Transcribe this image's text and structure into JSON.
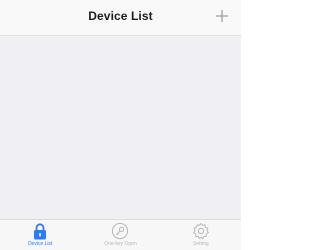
{
  "header": {
    "title": "Device List",
    "add_icon": "plus-icon"
  },
  "tabs": [
    {
      "label": "Device List",
      "icon": "lock-icon",
      "active": true
    },
    {
      "label": "One-key Open",
      "icon": "key-icon",
      "active": false
    },
    {
      "label": "Setting",
      "icon": "gear-icon",
      "active": false
    }
  ],
  "colors": {
    "accent": "#2f7bf5",
    "inactive": "#b7b7b7",
    "background": "#efeff4"
  }
}
